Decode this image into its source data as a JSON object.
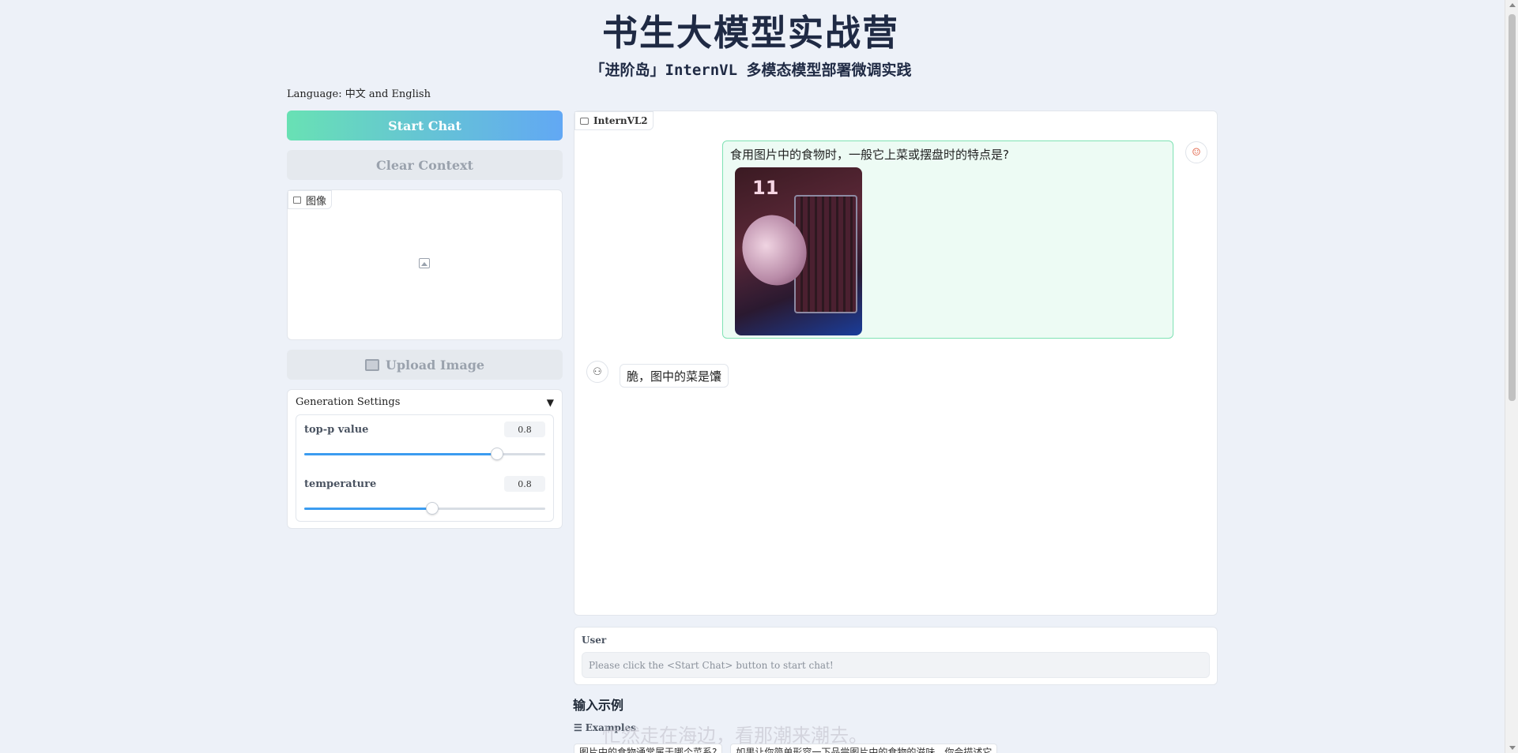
{
  "header": {
    "title": "书生大模型实战营",
    "subtitle": "「进阶岛」InternVL 多模态模型部署微调实践"
  },
  "language_note": "Language: 中文 and English",
  "left": {
    "start_chat": "Start Chat",
    "clear_context": "Clear Context",
    "image_tag": "图像",
    "upload_image": "Upload Image",
    "generation": {
      "title": "Generation Settings",
      "sliders": [
        {
          "label": "top-p value",
          "value": "0.8",
          "fraction": 0.8
        },
        {
          "label": "temperature",
          "value": "0.8",
          "fraction": 0.53
        }
      ]
    }
  },
  "chat": {
    "tag": "InternVL2",
    "user_message": "食用图片中的食物时，一般它上菜或摆盘时的特点是?",
    "image_number": "11",
    "bot_message": "脆，图中的菜是馕"
  },
  "input": {
    "label": "User",
    "placeholder": "Please click the <Start Chat> button to start chat!"
  },
  "examples": {
    "title": "输入示例",
    "tag": "Examples",
    "items": [
      "图片中的食物通常属于哪个菜系?",
      "如果让你简单形容一下品尝图片中的食物的滋味，你会描述它"
    ]
  },
  "subtitle_overlay": "忙然走在海边，看那潮来潮去。",
  "colors": {
    "accent_gradient_start": "#68e1b4",
    "accent_gradient_end": "#62a8f4",
    "slider_fill": "#3b9cf0",
    "user_bubble_border": "#7fe2b4"
  }
}
